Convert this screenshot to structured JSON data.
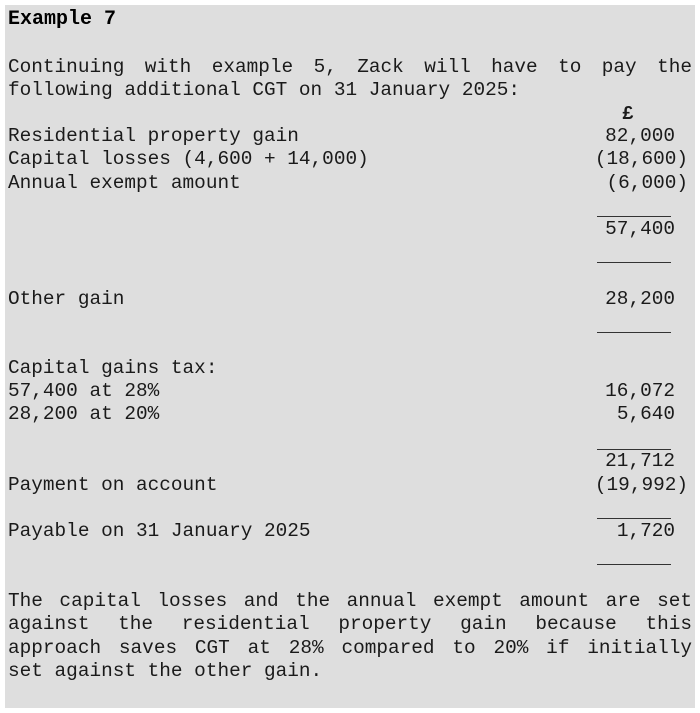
{
  "title": "Example 7",
  "intro": [
    "Continuing with example 5, Zack will have to pay the",
    "following additional CGT on 31 January 2025:"
  ],
  "currency_header": "£",
  "rows": [
    {
      "label": "Residential property gain",
      "amount": "82,000"
    },
    {
      "label": "Capital losses (4,600 + 14,000)",
      "amount": "(18,600)"
    },
    {
      "label": "Annual exempt amount",
      "amount": "(6,000)"
    },
    {
      "label": "",
      "amount": "57,400"
    },
    {
      "label": "Other gain",
      "amount": "28,200"
    },
    {
      "label": "Capital gains tax:",
      "amount": ""
    },
    {
      "label": "57,400 at 28%",
      "amount": "16,072"
    },
    {
      "label": "28,200 at 20%",
      "amount": "5,640"
    },
    {
      "label": "",
      "amount": "21,712"
    },
    {
      "label": "Payment on account",
      "amount": "(19,992)"
    },
    {
      "label": "Payable on 31 January 2025",
      "amount": "1,720"
    }
  ],
  "conclusion": [
    "The capital losses and the annual exempt amount are set",
    "against the residential property gain because this",
    "approach saves CGT at 28% compared to 20% if initially",
    "set against the other gain."
  ]
}
